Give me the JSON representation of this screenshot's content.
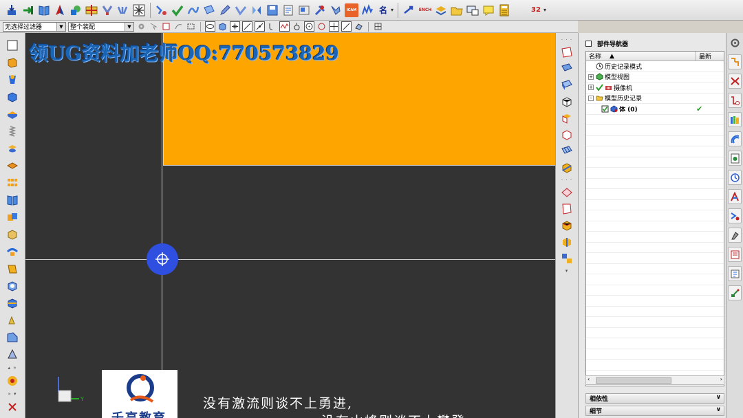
{
  "toolbar": {
    "icons": [
      "export-icon",
      "import-icon",
      "book-icon",
      "measure-icon",
      "shape-icon",
      "assembly-icon",
      "constraint-icon",
      "align-icon",
      "grid-icon",
      "sketch-icon",
      "check-icon",
      "curve-icon",
      "surface-icon",
      "edit-icon",
      "blend-icon",
      "mirror-icon",
      "save-icon",
      "layer-icon",
      "component-icon",
      "cam-icon",
      "analysis-icon",
      "name-icon",
      "arrow-icon",
      "ench-icon",
      "stack-icon",
      "folder-icon",
      "monitor-icon",
      "note-icon",
      "calculator-icon",
      "moon-icon",
      "number-icon"
    ],
    "cam_label": "ICAM",
    "ench_label": "ENCH",
    "name_label": "名",
    "number_label": "32"
  },
  "filter_bar": {
    "filter_select": "无选择过滤器",
    "assembly_select": "整个装配"
  },
  "viewport": {
    "watermark": "领UG资料加老师QQ:770573829",
    "subtitle_line1": "没有激流则谈不上勇进,",
    "subtitle_line2": "没有山峰则谈不上攀登.",
    "logo_text": "千亨教育",
    "triad_y_label": "Y",
    "colors": {
      "background": "#333333",
      "face": "#ffa500",
      "handle": "#2f4fe0",
      "watermark": "#1a64b4"
    }
  },
  "navigator": {
    "title": "部件导航器",
    "col_name": "名称",
    "col_latest": "最新",
    "rows": [
      {
        "label": "历史记录模式",
        "icon": "clock-icon",
        "expand": "",
        "latest": ""
      },
      {
        "label": "模型视图",
        "icon": "view-icon",
        "expand": "+",
        "latest": ""
      },
      {
        "label": "摄像机",
        "icon": "camera-icon",
        "expand": "+",
        "latest": ""
      },
      {
        "label": "模型历史记录",
        "icon": "folder-icon",
        "expand": "-",
        "latest": ""
      },
      {
        "label": "体 (0)",
        "icon": "body-icon",
        "expand": "",
        "latest": "✔"
      }
    ],
    "sections": {
      "dependencies": "相依性",
      "details": "细节"
    }
  }
}
